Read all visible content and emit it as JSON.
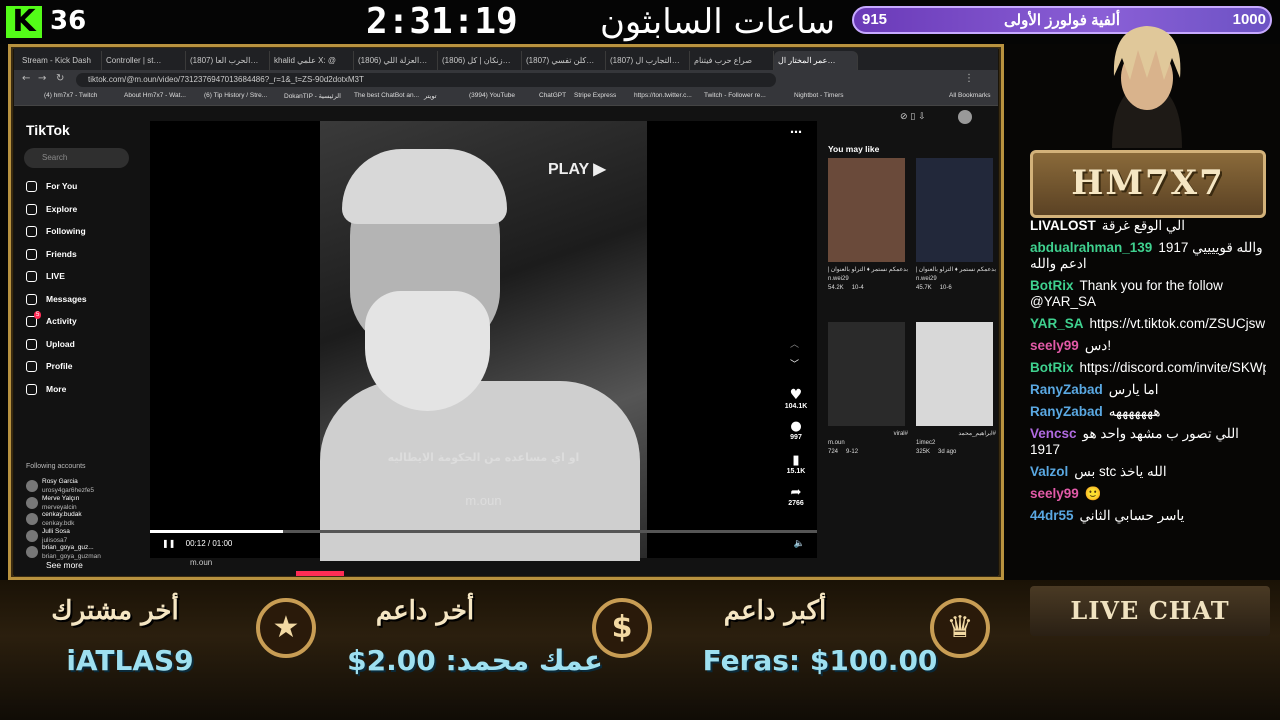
{
  "overlay": {
    "kick_count": "36",
    "timer": "2:31:19",
    "timer_label": "ساعات السابثون الباقيه:",
    "goal_current": "915",
    "goal_label": "ألفية فولورز الأولى",
    "goal_target": "1000",
    "goal_progress_fraction": 0.915,
    "streamer_name": "HM7X7",
    "live_chat_label": "LIVE CHAT"
  },
  "browser": {
    "tabs": [
      "Stream - Kick Dash",
      "Controller | st…",
      "(1807) الحرب العا…",
      "khalid علمي X: @",
      "(1806) العزلة اللي…",
      "(1806) زنكان | كل…",
      "(1807) كلن تفسي…",
      "(1807) التجارب ال…",
      "صراع حرب فيتنام",
      "عمر المختار ال…"
    ],
    "url": "tiktok.com/@m.oun/video/7312376947013684486?_r=1&_t=ZS-90d2dotxM3T",
    "bookmarks": [
      "(4) hm7x7 - Twitch",
      "About Hm7x7 - Wat...",
      "(6) Tip History / Stre...",
      "DokanTIP - الرئيسية",
      "The best ChatBot an...",
      "تويتر",
      "(3994) YouTube",
      "ChatGPT",
      "Stripe Express",
      "https://ton.twitter.c...",
      "Twitch - Follower re...",
      "Nightbot - Timers",
      "All Bookmarks"
    ]
  },
  "tiktok": {
    "logo": "TikTok",
    "search_placeholder": "Search",
    "nav": [
      "For You",
      "Explore",
      "Following",
      "Friends",
      "LIVE",
      "Messages",
      "Activity",
      "Upload",
      "Profile",
      "More"
    ],
    "activity_badge": "5",
    "following_title": "Following accounts",
    "following": [
      {
        "name": "Rosy Garcia",
        "handle": "urosy4gar6hezfe5"
      },
      {
        "name": "Merve Yalçın",
        "handle": "merveyalcin"
      },
      {
        "name": "cenkay.budak",
        "handle": "cenkay.bdk"
      },
      {
        "name": "Julli Sosa",
        "handle": "julisosa7"
      },
      {
        "name": "brian_goya_guz...",
        "handle": "brian_goya_guzman"
      }
    ],
    "see_more": "See more",
    "video": {
      "watermark_play": "PLAY ▶",
      "subtitle": "او اي مساعده من الحكومة الايطاليه",
      "watermark": "m.oun",
      "time": "00:12 / 01:00",
      "progress_fraction": 0.2,
      "likes": "104.1K",
      "comments": "997",
      "saves": "15.1K",
      "shares": "2766",
      "author": "m.oun"
    },
    "you_may_like": "You may like",
    "suggestions": [
      {
        "caption": "بدعمكم نستمر ♦ الترلو بالعنوان | ٣٠الف متابع مايكون",
        "author": "n.wei29",
        "likes": "54.2K",
        "date": "10-4"
      },
      {
        "caption": "بدعمكم نستمر ♦ الترلو بالعنوان | ٣٠الف متابع مايكون",
        "author": "n.wei29",
        "likes": "45.7K",
        "date": "10-6"
      },
      {
        "caption": "#viral",
        "author": "m.oun",
        "likes": "724",
        "date": "9-12"
      },
      {
        "caption": "#ابراهيم_محمد",
        "author": "1imec2",
        "likes": "325K",
        "date": "3d ago"
      }
    ]
  },
  "chat": [
    {
      "user": "LIVALOST",
      "text": "الي الوقع غرقة",
      "color": "#ffffff"
    },
    {
      "user": "abdualrahman_139",
      "text": "والله قوييييي 1917 ادعم والله",
      "color": "#3fd18f"
    },
    {
      "user": "BotRix",
      "text": "Thank you for the follow @YAR_SA",
      "color": "#3fd18f"
    },
    {
      "user": "YAR_SA",
      "text": "https://vt.tiktok.com/ZSUCjswE8/",
      "color": "#3fd18f"
    },
    {
      "user": "seely99",
      "text": "دس!",
      "color": "#e25aa8"
    },
    {
      "user": "BotRix",
      "text": "https://discord.com/invite/SKWpwXhW",
      "color": "#3fd18f"
    },
    {
      "user": "RanyZabad",
      "text": "اما يارس",
      "color": "#5aa8e2"
    },
    {
      "user": "RanyZabad",
      "text": "هههههههه",
      "color": "#5aa8e2"
    },
    {
      "user": "Vencsc",
      "text": "اللي تصور ب مشهد واحد هو 1917",
      "color": "#b06ae0"
    },
    {
      "user": "Valzol",
      "text": "بس stc الله ياخذ",
      "color": "#5aa8e2"
    },
    {
      "user": "seely99",
      "text": "🙂",
      "color": "#e25aa8"
    },
    {
      "user": "44dr55",
      "text": "ياسر حسابي الثاني",
      "color": "#5aa8e2"
    }
  ],
  "bottom": {
    "latest_sub_title": "أخر مشترك",
    "latest_sub_value": "iATLAS9",
    "latest_donor_title": "أخر داعم",
    "latest_donor_value": "عمك محمد: 2.00$",
    "top_donor_title": "أكبر داعم",
    "top_donor_value": "Feras: $100.00"
  },
  "colors": {
    "kick_green": "#53fc18",
    "gold": "#c89d54",
    "value_cyan": "#9ee0f0"
  }
}
